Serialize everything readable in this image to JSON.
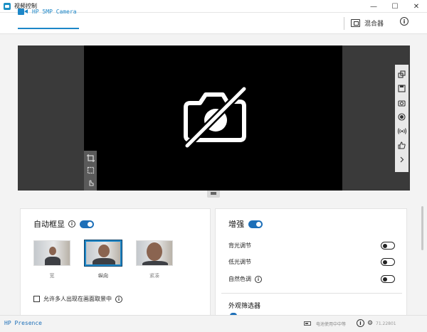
{
  "window": {
    "title": "视频控制",
    "controls": {
      "minimize": "—",
      "maximize": "☐",
      "close": "✕"
    }
  },
  "header": {
    "camera_tab": "HP 5MP Camera",
    "mixer_label": "混合器",
    "info_symbol": "i"
  },
  "preview": {
    "state": "camera-off",
    "icon": "camera-off-icon"
  },
  "left_tools": [
    "crop-icon",
    "crop-resize-icon",
    "touch-icon"
  ],
  "right_tools": [
    "copy-icon",
    "save-icon",
    "camera-capture-icon",
    "record-icon",
    "broadcast-icon",
    "thumbs-up-icon",
    "chevron-right-icon"
  ],
  "auto_frame": {
    "title": "自动框显",
    "enabled": true,
    "thumbnails": [
      {
        "label": "宽",
        "selected": false
      },
      {
        "label": "纵向",
        "selected": true
      },
      {
        "label": "紧凑",
        "selected": false
      }
    ],
    "multi_person_label": "允许多人出现在画面取景中",
    "multi_person_checked": false
  },
  "enhance": {
    "title": "增强",
    "enabled": true,
    "rows": [
      {
        "label": "背光调节",
        "on": false,
        "info": false
      },
      {
        "label": "低光调节",
        "on": false,
        "info": false
      },
      {
        "label": "自然色调",
        "on": false,
        "info": true
      }
    ],
    "filters_title": "外观筛选器"
  },
  "status": {
    "brand": "HP Presence",
    "power_text": "电池使用中中等",
    "version": "71.22801"
  },
  "colors": {
    "accent": "#1d87c8",
    "toggle": "#1d6fb8"
  }
}
